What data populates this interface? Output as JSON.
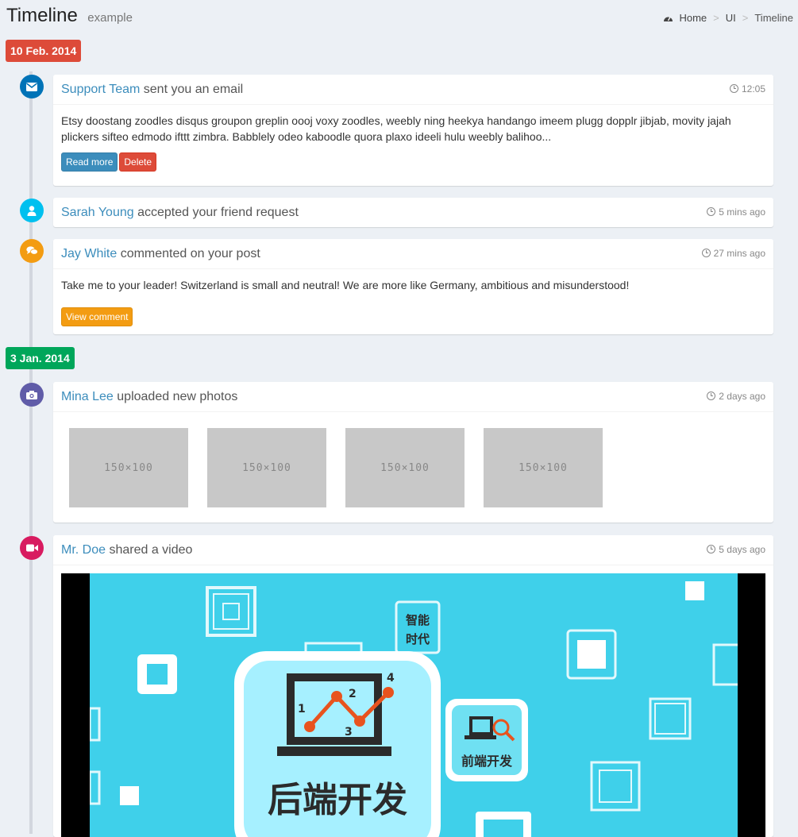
{
  "header": {
    "title": "Timeline",
    "subtitle": "example"
  },
  "breadcrumb": {
    "home": "Home",
    "section": "UI",
    "current": "Timeline"
  },
  "dates": [
    {
      "label": "10 Feb. 2014",
      "color": "#dd4b39"
    },
    {
      "label": "3 Jan. 2014",
      "color": "#00a65a"
    }
  ],
  "items": [
    {
      "icon": "envelope-icon",
      "icon_color": "#0073b7",
      "user": "Support Team",
      "action": " sent you an email",
      "time": "12:05",
      "body": "Etsy doostang zoodles disqus groupon greplin oooj voxy zoodles, weebly ning heekya handango imeem plugg dopplr jibjab, movity jajah plickers sifteo edmodo ifttt zimbra. Babblely odeo kaboodle quora plaxo ideeli hulu weebly balihoo...",
      "buttons": [
        "Read more",
        "Delete"
      ]
    },
    {
      "icon": "user-icon",
      "icon_color": "#00c0ef",
      "user": "Sarah Young",
      "action": " accepted your friend request",
      "time": "5 mins ago"
    },
    {
      "icon": "comments-icon",
      "icon_color": "#f39c12",
      "user": "Jay White",
      "action": " commented on your post",
      "time": "27 mins ago",
      "body": "Take me to your leader! Switzerland is small and neutral! We are more like Germany, ambitious and misunderstood!",
      "buttons": [
        "View comment"
      ]
    },
    {
      "icon": "camera-icon",
      "icon_color": "#605ca8",
      "user": "Mina Lee",
      "action": " uploaded new photos",
      "time": "2 days ago",
      "photos": [
        "150×100",
        "150×100",
        "150×100",
        "150×100"
      ]
    },
    {
      "icon": "video-camera-icon",
      "icon_color": "#d81b60",
      "user": "Mr. Doe",
      "action": " shared a video",
      "time": "5 days ago",
      "video": {
        "main_caption": "后端开发",
        "side_caption": "前端开发",
        "tag_caption_1": "智能",
        "tag_caption_2": "时代",
        "points": [
          "1",
          "2",
          "3",
          "4"
        ]
      }
    }
  ]
}
